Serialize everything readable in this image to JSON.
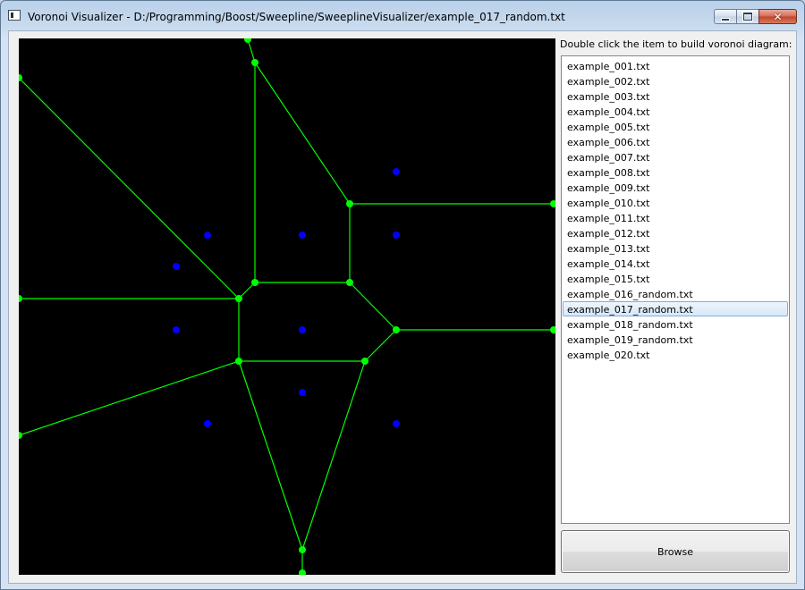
{
  "window": {
    "title": "Voronoi Visualizer - D:/Programming/Boost/Sweepline/SweeplineVisualizer/example_017_random.txt",
    "close_glyph": "✕"
  },
  "colors": {
    "edge": "#00ff00",
    "vertex": "#00ff00",
    "site": "#0000ff",
    "canvas_background": "#000000",
    "selection": "#d6e8fa"
  },
  "sidebar": {
    "instruction": "Double click the item to build voronoi diagram:",
    "files": [
      "example_001.txt",
      "example_002.txt",
      "example_003.txt",
      "example_004.txt",
      "example_005.txt",
      "example_006.txt",
      "example_007.txt",
      "example_008.txt",
      "example_009.txt",
      "example_010.txt",
      "example_011.txt",
      "example_012.txt",
      "example_013.txt",
      "example_014.txt",
      "example_015.txt",
      "example_016_random.txt",
      "example_017_random.txt",
      "example_018_random.txt",
      "example_019_random.txt",
      "example_020.txt"
    ],
    "selected_file": "example_017_random.txt",
    "browse_label": "Browse"
  },
  "icons": {
    "app": "app-window-icon",
    "minimize": "minimize-icon",
    "maximize": "maximize-icon",
    "close": "close-icon"
  }
}
